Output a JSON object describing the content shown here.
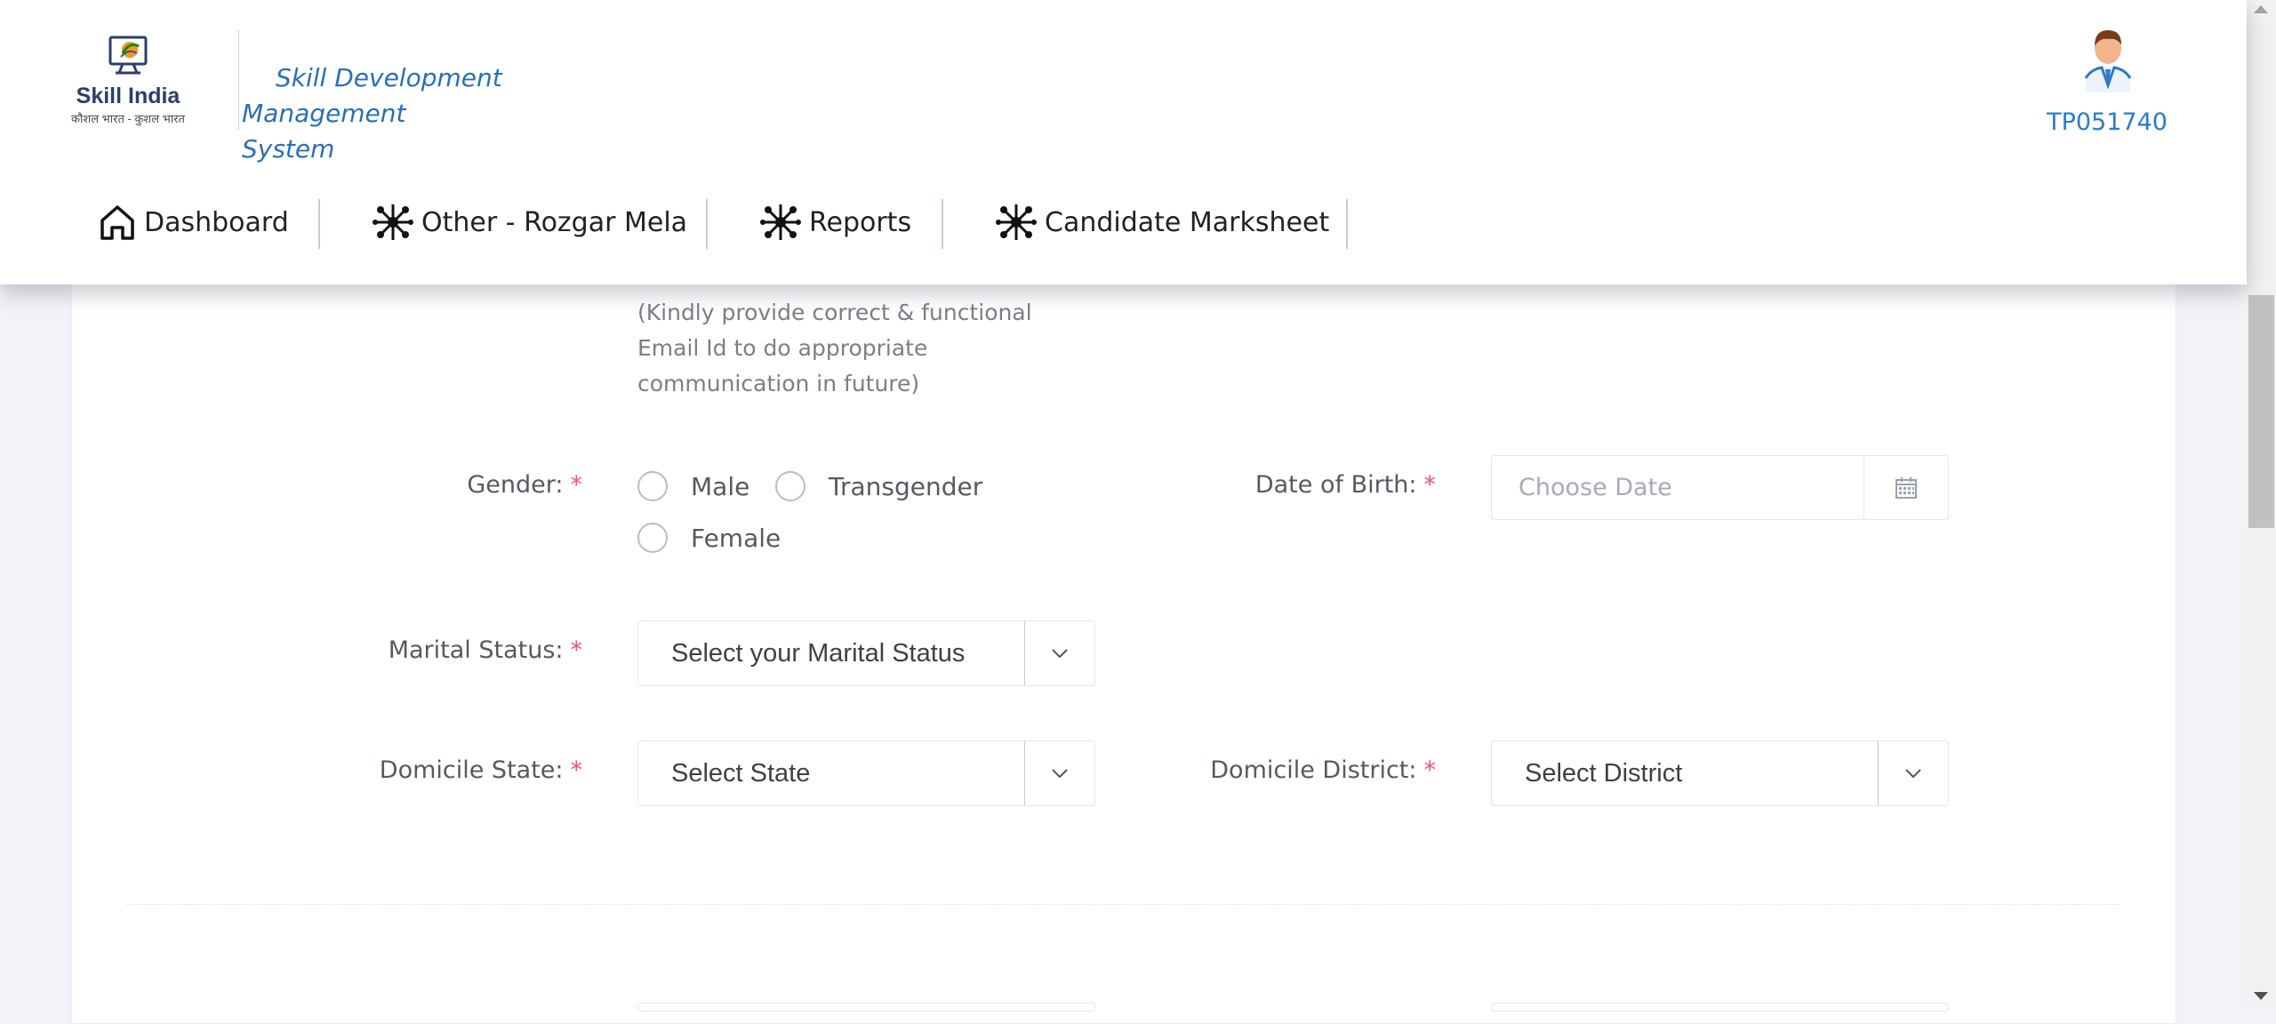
{
  "brand": {
    "logo_title": "Skill India",
    "logo_subtitle": "कौशल भारत - कुशल भारत",
    "app_title_line1": "Skill Development Management",
    "app_title_line2": "System"
  },
  "user": {
    "id": "TP051740",
    "avatar_icon": "user-avatar-icon"
  },
  "nav": {
    "items": [
      {
        "label": "Dashboard",
        "icon": "home-icon"
      },
      {
        "label": "Other - Rozgar Mela",
        "icon": "network-icon"
      },
      {
        "label": "Reports",
        "icon": "network-icon"
      },
      {
        "label": "Candidate Marksheet",
        "icon": "network-icon"
      }
    ]
  },
  "form": {
    "email_hint": "(Kindly provide correct & functional Email Id to do appropriate communication in future)",
    "required_marker": "*",
    "gender": {
      "label": "Gender:",
      "options": [
        "Male",
        "Transgender",
        "Female"
      ]
    },
    "dob": {
      "label": "Date of Birth:",
      "placeholder": "Choose Date",
      "icon": "calendar-icon"
    },
    "marital_status": {
      "label": "Marital Status:",
      "value": "Select your Marital Status"
    },
    "domicile_state": {
      "label": "Domicile State:",
      "value": "Select State"
    },
    "domicile_district": {
      "label": "Domicile District:",
      "value": "Select District"
    }
  },
  "colors": {
    "accent_blue": "#2a7cc7",
    "required_red": "#f4516c",
    "page_bg": "#f2f3f8"
  }
}
